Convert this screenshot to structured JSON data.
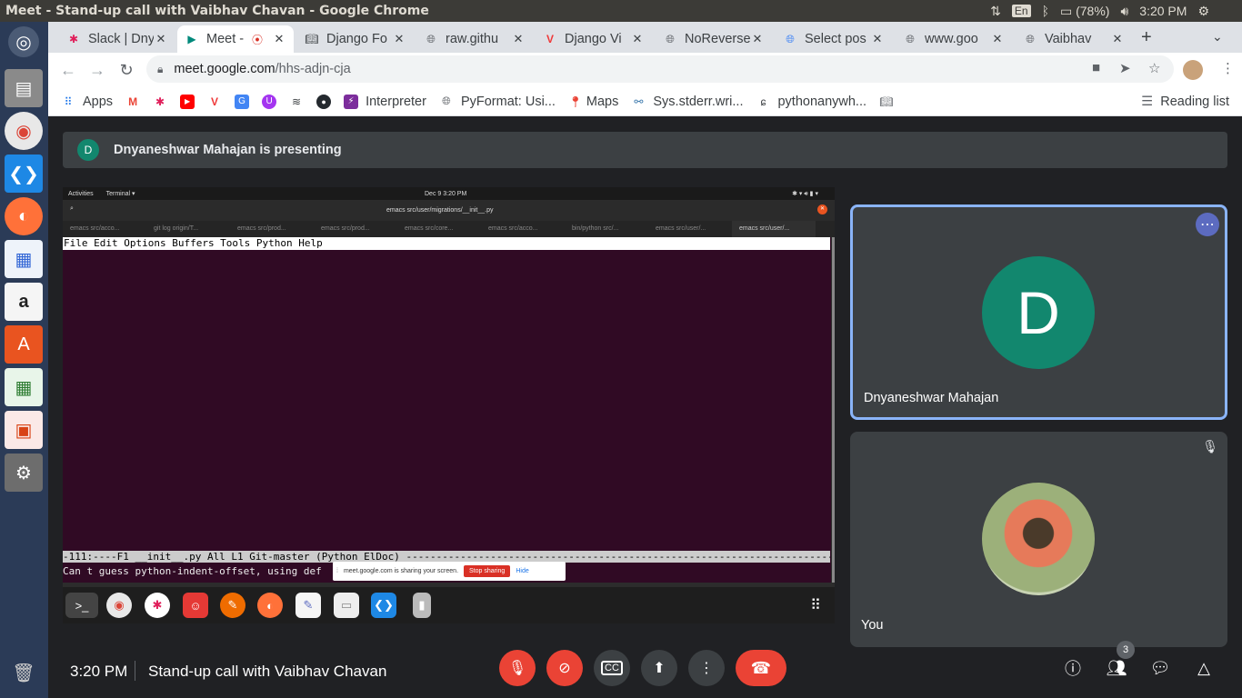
{
  "window": {
    "title": "Meet - Stand-up call with Vaibhav Chavan - Google Chrome"
  },
  "tray": {
    "lang": "En",
    "battery": "(78%)",
    "clock": "3:20 PM"
  },
  "tabs": [
    {
      "label": "Slack | Dny",
      "icon": "slack-icon"
    },
    {
      "label": "Meet -",
      "icon": "meet-icon",
      "recording": true
    },
    {
      "label": "Django Fo",
      "icon": "book-icon"
    },
    {
      "label": "raw.githu",
      "icon": "globe-icon"
    },
    {
      "label": "Django Vi",
      "icon": "vivaldi-v-icon"
    },
    {
      "label": "NoReverse",
      "icon": "globe-icon"
    },
    {
      "label": "Select pos",
      "icon": "google-icon"
    },
    {
      "label": "www.goo",
      "icon": "globe-icon"
    },
    {
      "label": "Vaibhav",
      "icon": "globe-icon"
    }
  ],
  "address": {
    "domain": "meet.google.com",
    "path": "/hhs-adjn-cja"
  },
  "bookmarks": [
    {
      "label": "Apps",
      "icon": "apps-grid-icon"
    },
    {
      "label": "",
      "icon": "gmail-icon"
    },
    {
      "label": "",
      "icon": "slack-icon"
    },
    {
      "label": "",
      "icon": "youtube-icon"
    },
    {
      "label": "",
      "icon": "vivaldi-v-icon"
    },
    {
      "label": "",
      "icon": "translate-icon"
    },
    {
      "label": "",
      "icon": "udemy-icon"
    },
    {
      "label": "",
      "icon": "stackoverflow-icon"
    },
    {
      "label": "",
      "icon": "github-icon"
    },
    {
      "label": "Interpreter",
      "icon": "lightning-icon"
    },
    {
      "label": "PyFormat: Usi...",
      "icon": "globe-icon"
    },
    {
      "label": "Maps",
      "icon": "maps-pin-icon"
    },
    {
      "label": "Sys.stderr.wri...",
      "icon": "python-icon"
    },
    {
      "label": "pythonanywh...",
      "icon": "spiral-icon"
    },
    {
      "label": "",
      "icon": "book-icon"
    }
  ],
  "reading_list": "Reading list",
  "meet": {
    "presenting_initial": "D",
    "presenting_text": "Dnyaneshwar Mahajan is presenting",
    "participants": [
      {
        "name": "Dnyaneshwar Mahajan",
        "initial": "D",
        "avatar_color": "#12876e"
      },
      {
        "name": "You",
        "initial": ""
      }
    ],
    "time": "3:20 PM",
    "meeting_title": "Stand-up call with Vaibhav Chavan",
    "people_count": "3"
  },
  "shared_screen": {
    "activities": "Activities",
    "terminal_menu": "Terminal ▾",
    "date": "Dec 9  3:20 PM",
    "window_title": "emacs src/user/migrations/__init__.py",
    "term_tabs": [
      "emacs src/acco...",
      "git log origin/T...",
      "emacs src/prod...",
      "emacs src/prod...",
      "emacs src/core...",
      "emacs src/acco...",
      "bin/python src/...",
      "emacs src/user/...",
      "emacs src/user/..."
    ],
    "emacs_menu": "File Edit Options Buffers Tools Python Help",
    "modeline": "-111:----F1   __init__.py    All L1    Git-master  (Python ElDoc) ------------------------------------------------------------------------------------",
    "echo": "Can t guess python-indent-offset, using def",
    "share_notice": "meet.google.com is sharing your screen.",
    "stop_sharing": "Stop sharing",
    "hide": "Hide"
  }
}
